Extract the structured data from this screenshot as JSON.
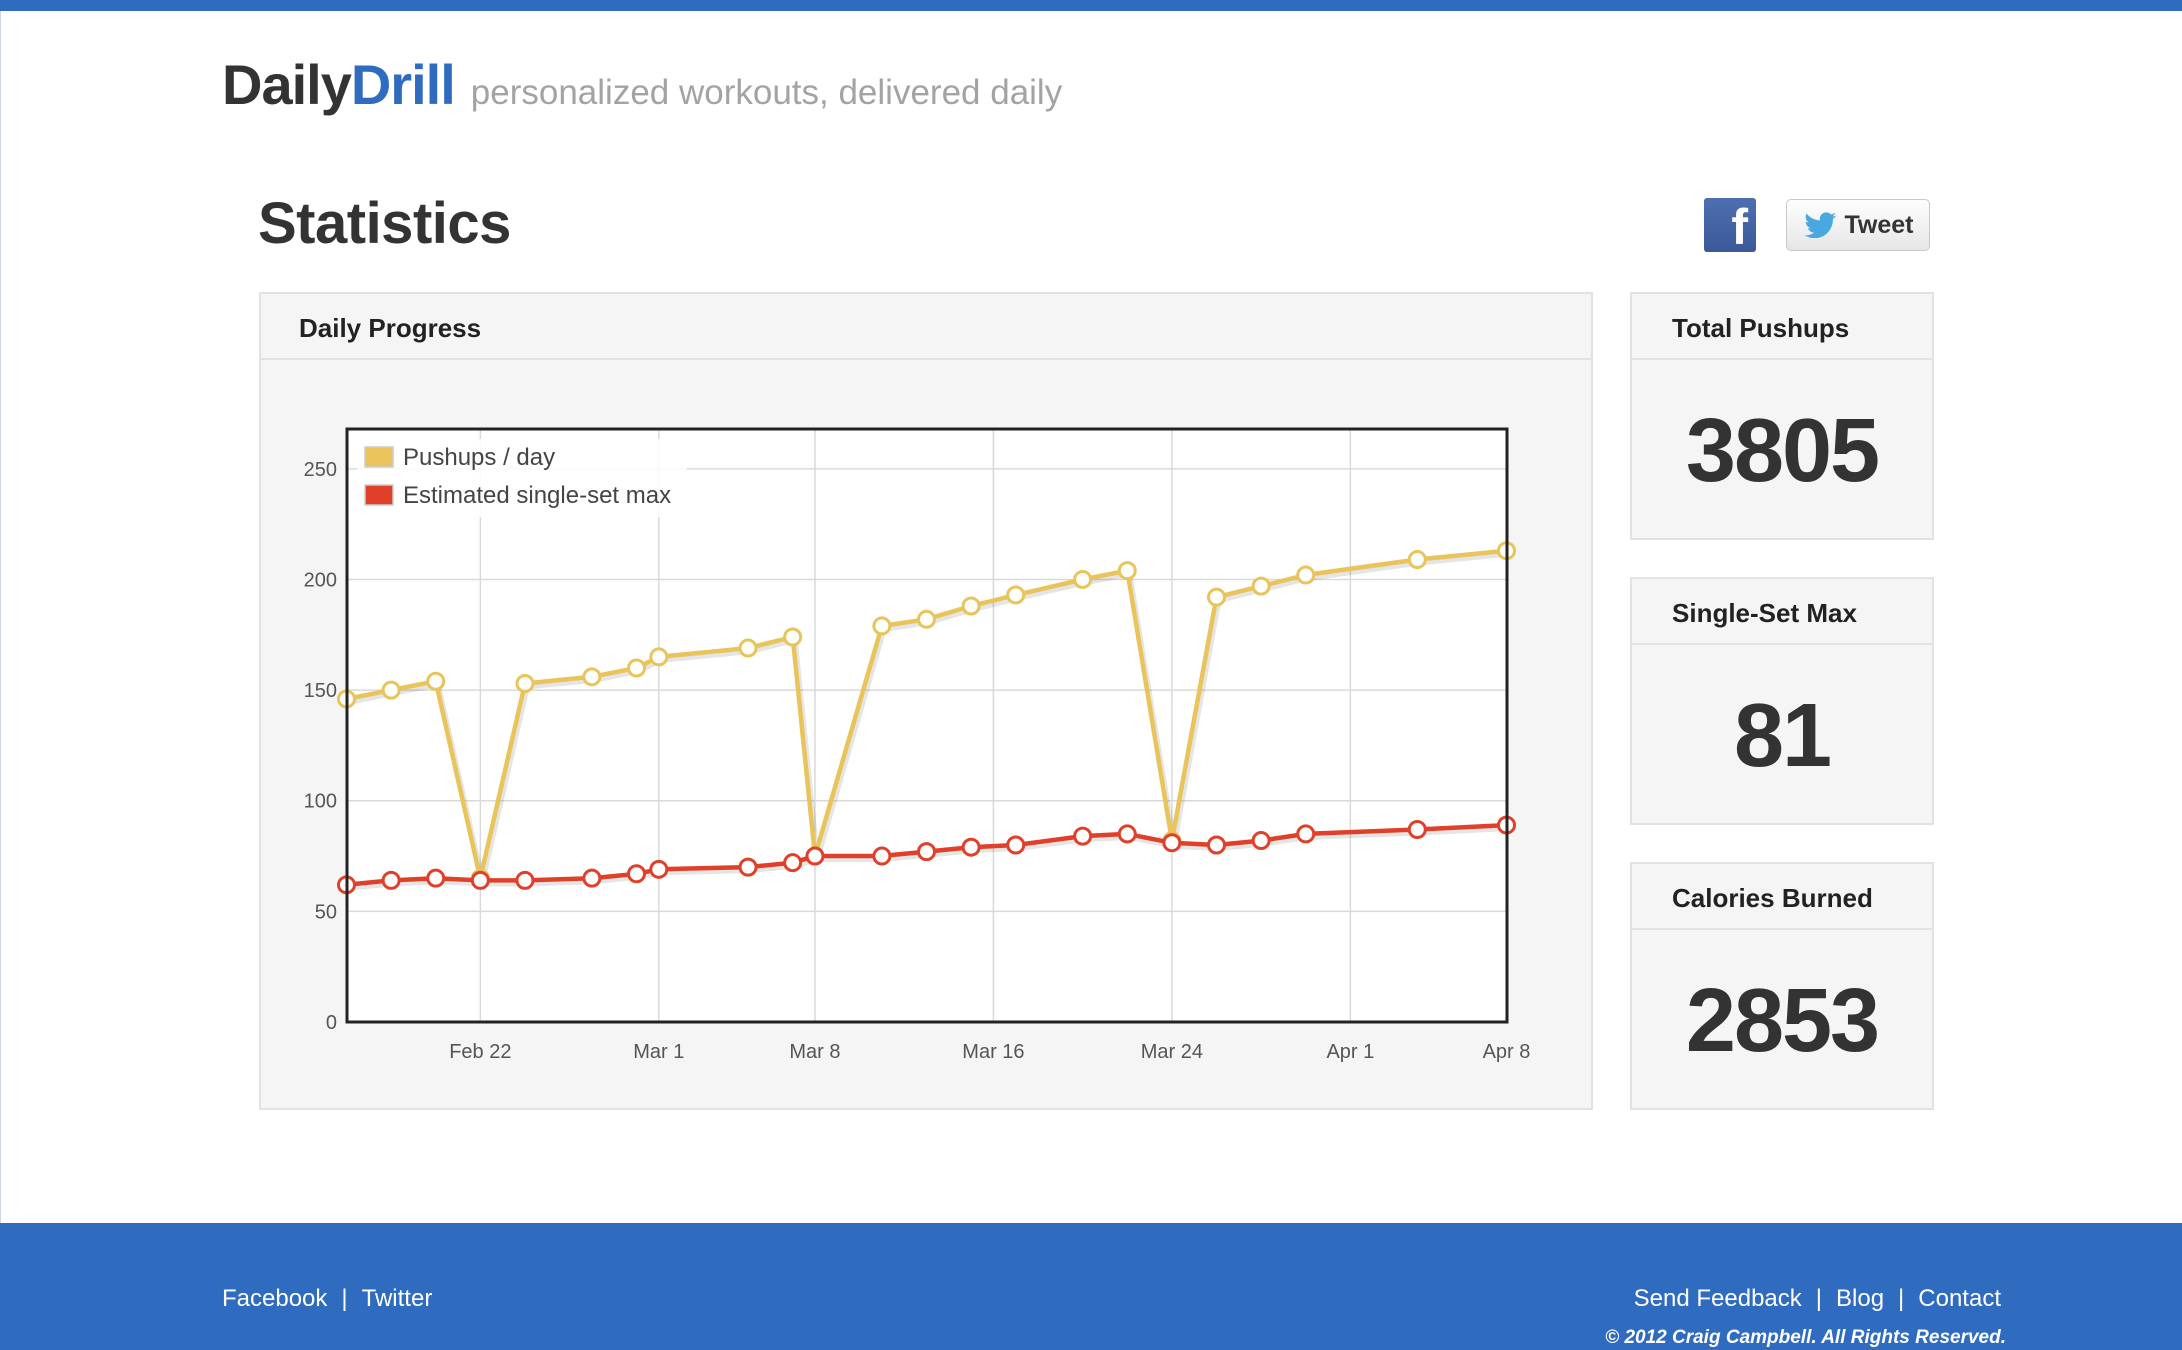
{
  "brand": {
    "name_part1": "Daily",
    "name_part2": "Drill",
    "tagline": "personalized workouts, delivered daily"
  },
  "page_title": "Statistics",
  "share": {
    "facebook_icon": "facebook-icon",
    "tweet_label": "Tweet",
    "twitter_icon": "twitter-bird-icon"
  },
  "daily_progress": {
    "title": "Daily Progress"
  },
  "stats": [
    {
      "label": "Total Pushups",
      "value": "3805"
    },
    {
      "label": "Single-Set Max",
      "value": "81"
    },
    {
      "label": "Calories Burned",
      "value": "2853"
    }
  ],
  "footer": {
    "left_links": [
      "Facebook",
      "Twitter"
    ],
    "right_links": [
      "Send Feedback",
      "Blog",
      "Contact"
    ],
    "copyright": "© 2012 Craig Campbell. All Rights Reserved."
  },
  "colors": {
    "brand_blue": "#2f6bbf",
    "pushups_series": "#e8c45a",
    "max_series": "#e0402a"
  },
  "chart_data": {
    "type": "line",
    "title": "",
    "xlabel": "",
    "ylabel": "",
    "x_tick_labels": [
      "Feb 22",
      "Mar 1",
      "Mar 8",
      "Mar 16",
      "Mar 24",
      "Apr 1",
      "Apr 8"
    ],
    "x_ticks": [
      "2012-02-22",
      "2012-03-01",
      "2012-03-08",
      "2012-03-16",
      "2012-03-24",
      "2012-04-01",
      "2012-04-08"
    ],
    "xlim": [
      "2012-02-16",
      "2012-04-08"
    ],
    "ylim": [
      0,
      268
    ],
    "y_ticks": [
      0,
      50,
      100,
      150,
      200,
      250
    ],
    "grid": true,
    "legend": "top-left",
    "series": [
      {
        "name": "Pushups / day",
        "color": "#e8c45a",
        "points": [
          [
            "2012-02-16",
            146
          ],
          [
            "2012-02-18",
            150
          ],
          [
            "2012-02-20",
            154
          ],
          [
            "2012-02-22",
            65
          ],
          [
            "2012-02-24",
            153
          ],
          [
            "2012-02-27",
            156
          ],
          [
            "2012-02-29",
            160
          ],
          [
            "2012-03-01",
            165
          ],
          [
            "2012-03-05",
            169
          ],
          [
            "2012-03-07",
            174
          ],
          [
            "2012-03-08",
            75
          ],
          [
            "2012-03-11",
            179
          ],
          [
            "2012-03-13",
            182
          ],
          [
            "2012-03-15",
            188
          ],
          [
            "2012-03-17",
            193
          ],
          [
            "2012-03-20",
            200
          ],
          [
            "2012-03-22",
            204
          ],
          [
            "2012-03-24",
            82
          ],
          [
            "2012-03-26",
            192
          ],
          [
            "2012-03-28",
            197
          ],
          [
            "2012-03-30",
            202
          ],
          [
            "2012-04-04",
            209
          ],
          [
            "2012-04-08",
            213
          ]
        ]
      },
      {
        "name": "Estimated single-set max",
        "color": "#e0402a",
        "points": [
          [
            "2012-02-16",
            62
          ],
          [
            "2012-02-18",
            64
          ],
          [
            "2012-02-20",
            65
          ],
          [
            "2012-02-22",
            64
          ],
          [
            "2012-02-24",
            64
          ],
          [
            "2012-02-27",
            65
          ],
          [
            "2012-02-29",
            67
          ],
          [
            "2012-03-01",
            69
          ],
          [
            "2012-03-05",
            70
          ],
          [
            "2012-03-07",
            72
          ],
          [
            "2012-03-08",
            75
          ],
          [
            "2012-03-11",
            75
          ],
          [
            "2012-03-13",
            77
          ],
          [
            "2012-03-15",
            79
          ],
          [
            "2012-03-17",
            80
          ],
          [
            "2012-03-20",
            84
          ],
          [
            "2012-03-22",
            85
          ],
          [
            "2012-03-24",
            81
          ],
          [
            "2012-03-26",
            80
          ],
          [
            "2012-03-28",
            82
          ],
          [
            "2012-03-30",
            85
          ],
          [
            "2012-04-04",
            87
          ],
          [
            "2012-04-08",
            89
          ]
        ]
      }
    ]
  }
}
